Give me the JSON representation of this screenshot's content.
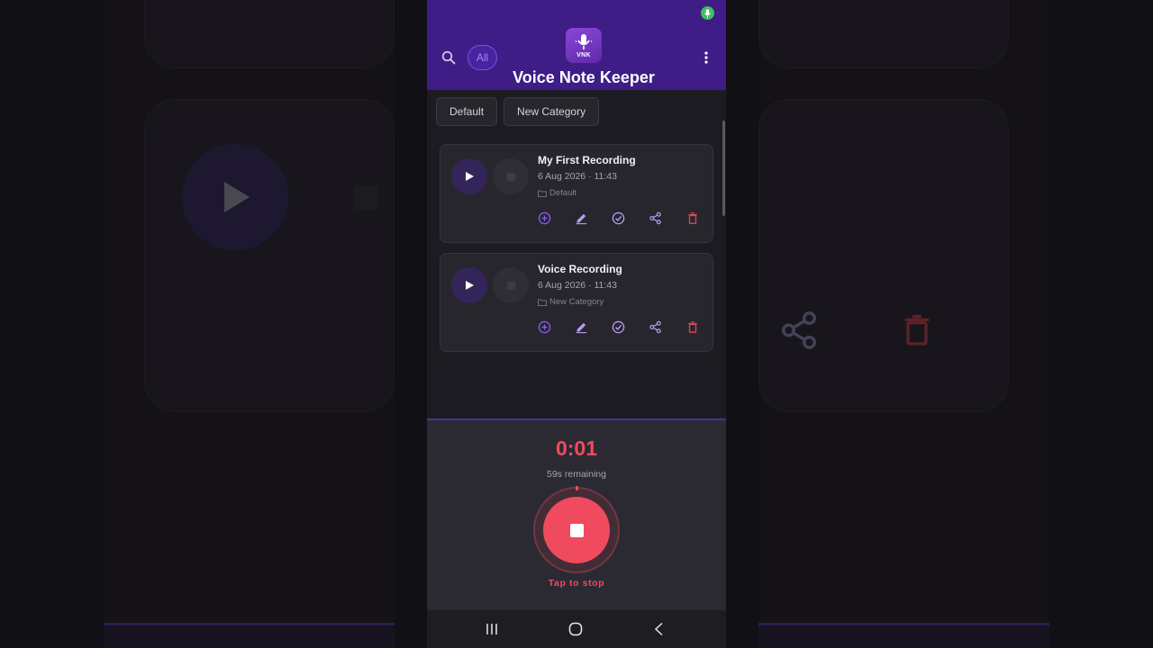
{
  "header": {
    "app_title": "Voice Note Keeper",
    "logo_text": "VNK",
    "filter_chip": "All"
  },
  "categories": [
    {
      "label": "Default"
    },
    {
      "label": "New Category"
    }
  ],
  "recordings": [
    {
      "title": "My First Recording",
      "date": "6 Aug 2026 · 11:43",
      "category": "Default"
    },
    {
      "title": "Voice Recording",
      "date": "6 Aug 2026 · 11:43",
      "category": "New Category"
    }
  ],
  "recorder": {
    "timer": "0:01",
    "remaining": "59s remaining",
    "hint": "Tap to stop"
  },
  "colors": {
    "header_bg": "#3f1d86",
    "accent": "#8b5cf6",
    "record_red": "#ef4a5e",
    "delete_red": "#e0455a",
    "mic_status_green": "#3fbf63"
  },
  "icons": {
    "mic_status": "microphone-icon",
    "search": "search-icon",
    "menu": "more-vertical-icon",
    "card_actions": [
      "add-circle-icon",
      "edit-icon",
      "check-circle-icon",
      "share-icon",
      "delete-icon"
    ],
    "nav": [
      "recent-apps-icon",
      "home-icon",
      "back-icon"
    ]
  }
}
